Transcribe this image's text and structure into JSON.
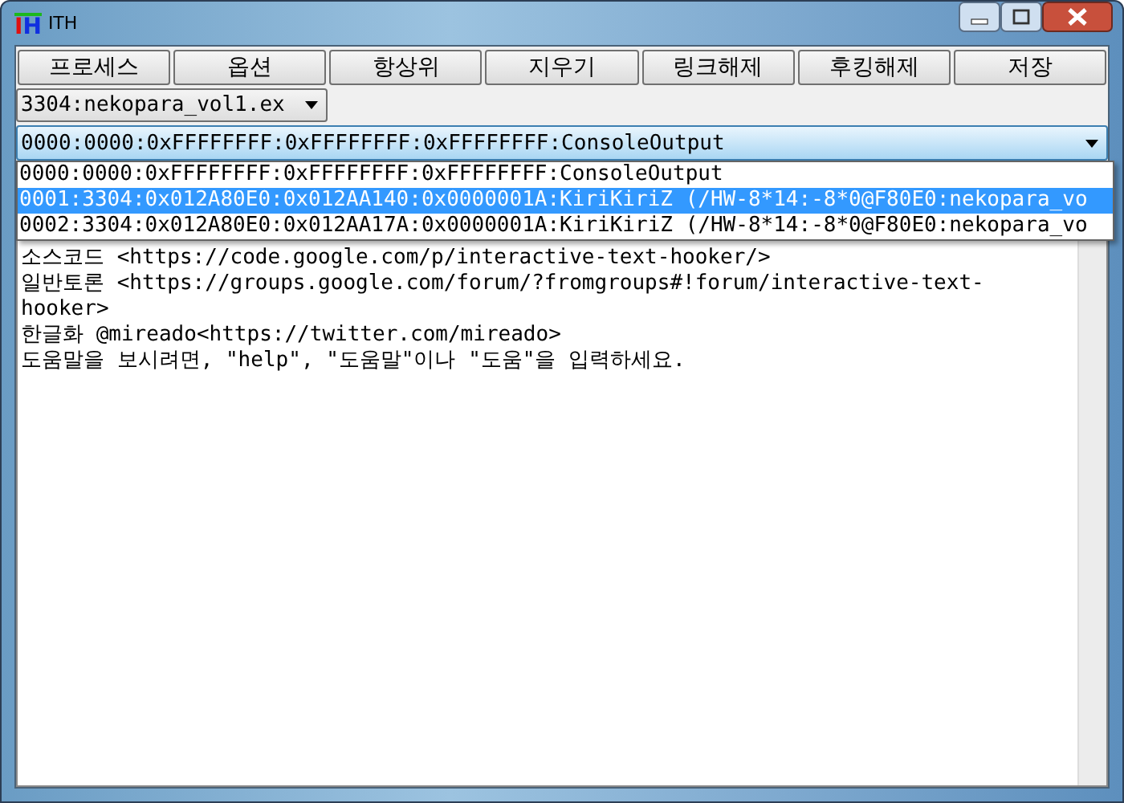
{
  "window": {
    "title": "ITH",
    "icon_letters": [
      "I",
      "H"
    ]
  },
  "toolbar": {
    "buttons": [
      "프로세스",
      "옵션",
      "항상위",
      "지우기",
      "링크해제",
      "후킹해제",
      "저장"
    ]
  },
  "process_select": {
    "value": "3304:nekopara_vol1.ex"
  },
  "hook_select": {
    "value": "0000:0000:0xFFFFFFFF:0xFFFFFFFF:0xFFFFFFFF:ConsoleOutput",
    "expanded": true,
    "options": [
      {
        "label": "0000:0000:0xFFFFFFFF:0xFFFFFFFF:0xFFFFFFFF:ConsoleOutput",
        "highlighted": false
      },
      {
        "label": "0001:3304:0x012A80E0:0x012AA140:0x0000001A:KiriKiriZ (/HW-8*14:-8*0@F80E0:nekopara_vo",
        "highlighted": true
      },
      {
        "label": "0002:3304:0x012A80E0:0x012AA17A:0x0000001A:KiriKiriZ (/HW-8*14:-8*0@F80E0:nekopara_vo",
        "highlighted": false
      }
    ]
  },
  "console": {
    "lines": [
      "소스코드 <https://code.google.com/p/interactive-text-hooker/>",
      "일반토론 <https://groups.google.com/forum/?fromgroups#!forum/interactive-text-hooker>",
      "한글화 @mireado<https://twitter.com/mireado>",
      "도움말을 보시려면, \"help\", \"도움말\"이나 \"도움\"을 입력하세요."
    ]
  }
}
